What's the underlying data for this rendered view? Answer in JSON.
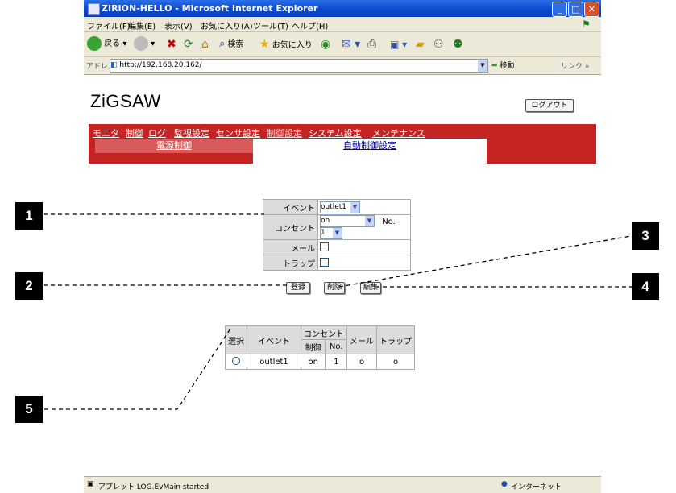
{
  "window": {
    "title": "ZIRION-HELLO - Microsoft Internet Explorer",
    "menu": [
      "ファイル(F)",
      "編集(E)",
      "表示(V)",
      "お気に入り(A)",
      "ツール(T)",
      "ヘルプ(H)"
    ],
    "toolbar": {
      "back": "戻る",
      "search": "検索",
      "favorites": "お気に入り"
    },
    "address_label": "アドレス(D)",
    "address": "http://192.168.20.162/",
    "go": "移動",
    "links": "リンク »",
    "status": "アプレット LOG.EvMain started",
    "zone": "インターネット"
  },
  "page": {
    "logo": "ZiGSAW",
    "logout": "ログアウト",
    "nav": [
      "モニタ",
      "制御",
      "ログ",
      "監視設定",
      "センサ設定",
      "制御設定",
      "システム設定",
      "メンテナンス"
    ],
    "subtabs": [
      "電源制御",
      "自動制御設定"
    ],
    "form": {
      "event_label": "イベント",
      "event_value": "outlet1",
      "outlet_label": "コンセント",
      "outlet_value": "on",
      "no_label": "No.",
      "no_value": "1",
      "mail_label": "メール",
      "trap_label": "トラップ"
    },
    "buttons": {
      "register": "登録",
      "delete": "削除",
      "edit": "編集"
    },
    "list": {
      "headers": {
        "select": "選択",
        "event": "イベント",
        "outlet": "コンセント",
        "control": "制御",
        "no": "No.",
        "mail": "メール",
        "trap": "トラップ"
      },
      "row": {
        "event": "outlet1",
        "control": "on",
        "no": "1",
        "mail": "o",
        "trap": "o"
      }
    }
  },
  "callouts": [
    "1",
    "2",
    "3",
    "4",
    "5"
  ]
}
